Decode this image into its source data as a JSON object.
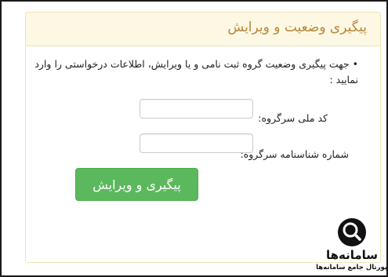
{
  "panel": {
    "title": "پیگیری وضعیت و ویرایش"
  },
  "instructions": {
    "bullet": "•",
    "text": "جهت پیگیری وضعیت گروه ثبت نامی و یا ویرایش، اطلاعات درخواستی را وارد نمایید :"
  },
  "form": {
    "national_id_label": "کد ملی سرگروه:",
    "national_id_value": "",
    "birth_cert_label": "شماره شناسنامه سرگروه:",
    "birth_cert_value": "",
    "submit_label": "پیگیری و ویرایش"
  },
  "watermark": {
    "icon": "search-icon",
    "brand": "سامانه‌ها",
    "tagline": "پورتال جامع سامانه‌ها"
  },
  "colors": {
    "header_bg": "#fcf8e3",
    "header_text": "#b7883c",
    "submit_bg": "#5cb85c"
  }
}
